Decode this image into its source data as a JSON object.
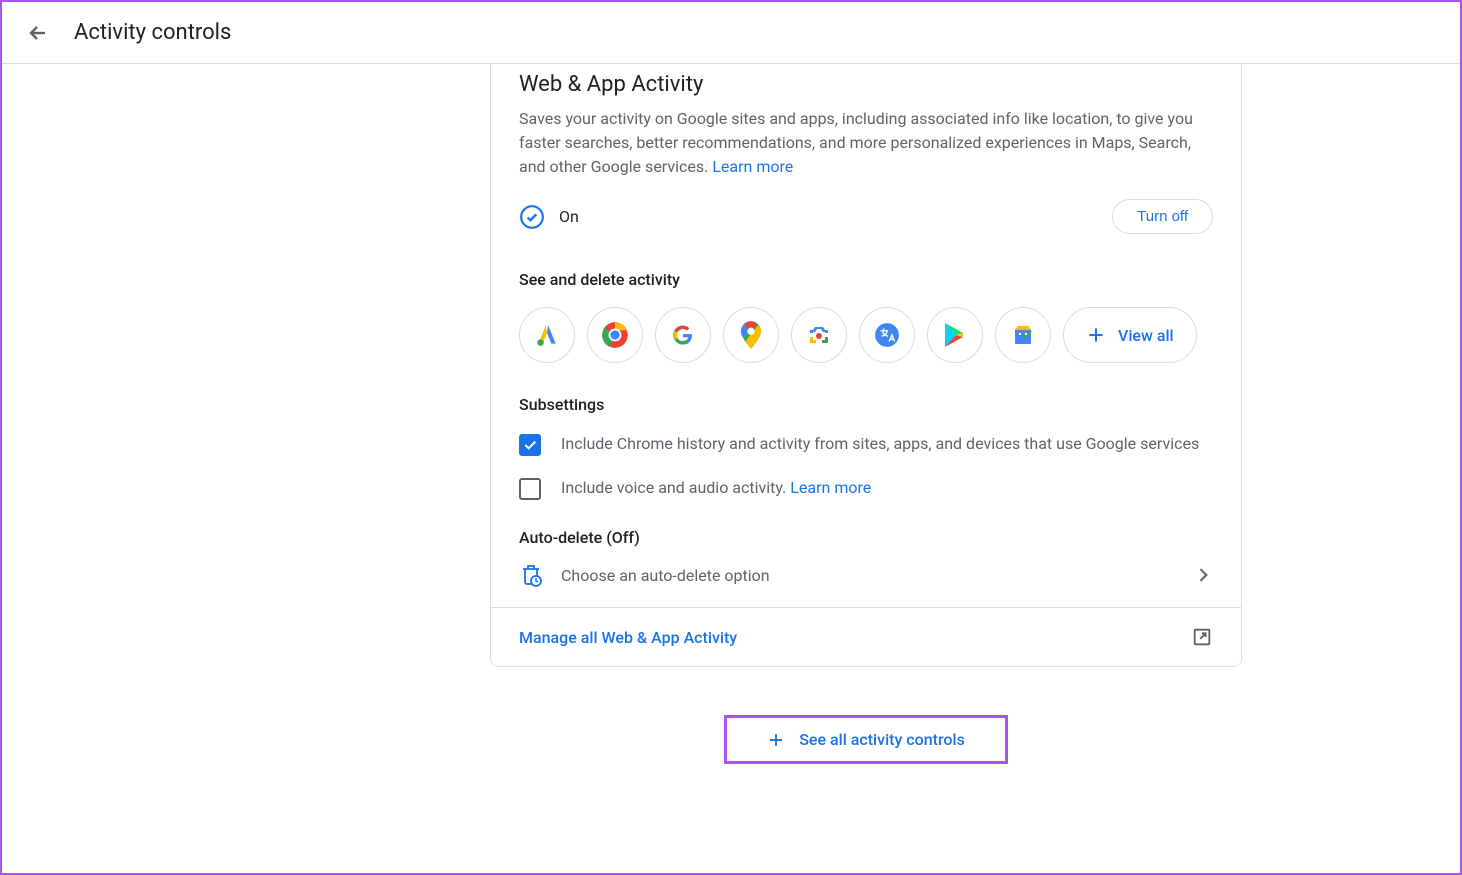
{
  "header": {
    "title": "Activity controls"
  },
  "main": {
    "title": "Web & App Activity",
    "description": "Saves your activity on Google sites and apps, including associated info like location, to give you faster searches, better recommendations, and more personalized experiences in Maps, Search, and other Google services. ",
    "learn_more": "Learn more",
    "status": "On",
    "turn_off": "Turn off",
    "see_delete_title": "See and delete activity",
    "view_all": "View all",
    "subsettings_title": "Subsettings",
    "sub1": "Include Chrome history and activity from sites, apps, and devices that use Google services",
    "sub2": "Include voice and audio activity. ",
    "sub2_link": "Learn more",
    "auto_delete_title": "Auto-delete (Off)",
    "auto_delete_option": "Choose an auto-delete option",
    "manage_link": "Manage all Web & App Activity"
  },
  "footer": {
    "see_all": "See all activity controls"
  },
  "icons": [
    "ads",
    "chrome",
    "google",
    "maps",
    "lens",
    "translate",
    "play",
    "shopping"
  ]
}
